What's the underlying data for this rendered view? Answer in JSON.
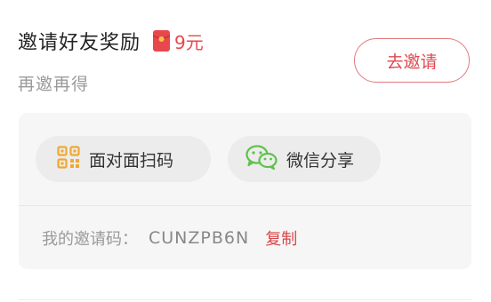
{
  "header": {
    "title": "邀请好友奖励",
    "reward_icon": "red-envelope-icon",
    "reward": "9元",
    "subtitle": "再邀再得",
    "invite_button": "去邀请"
  },
  "share_options": {
    "scan": {
      "icon": "qr-code-icon",
      "label": "面对面扫码"
    },
    "wechat": {
      "icon": "wechat-icon",
      "label": "微信分享"
    }
  },
  "invite_code": {
    "label": "我的邀请码：",
    "value": "CUNZPB6N",
    "copy_label": "复制"
  },
  "colors": {
    "accent": "#e0484e",
    "qr_icon": "#f0a832",
    "wechat_icon": "#5cc24a"
  }
}
